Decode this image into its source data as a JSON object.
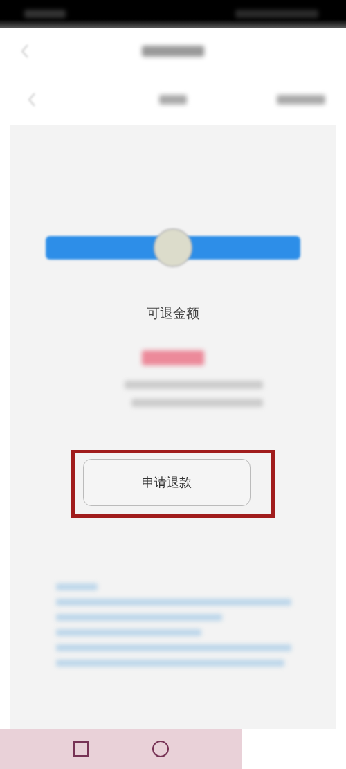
{
  "refund": {
    "label": "可退金额"
  },
  "apply_button": {
    "label": "申请退款",
    "highlighted": true
  },
  "nav_bar": {
    "buttons": [
      {
        "kind": "square"
      },
      {
        "kind": "circle"
      }
    ]
  }
}
